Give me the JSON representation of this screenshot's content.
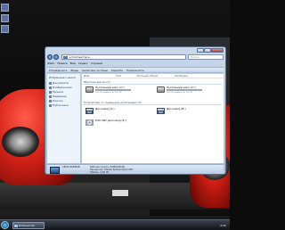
{
  "window": {
    "address": "▸ Компьютер ▸",
    "search_placeholder": "Поиск"
  },
  "menubar": [
    "Файл",
    "Правка",
    "Вид",
    "Сервис",
    "Справка"
  ],
  "toolbar": {
    "organize": "Упорядочить",
    "views": "Виды",
    "properties": "Свойства системы",
    "uninstall": "Удалить",
    "map_drive": "Подключить"
  },
  "nav": {
    "title": "Избранные ссылки",
    "items": [
      "Документы",
      "Изображения",
      "Музыка",
      "Недавние",
      "Поиски",
      "Публичные"
    ]
  },
  "columns": [
    "Имя",
    "Тип",
    "Полный объем",
    "Свободно"
  ],
  "groups": {
    "hard_disks": "Жесткие диски (2)",
    "removable": "Устройства со съемными носителями (3)"
  },
  "drives": [
    {
      "label": "Локальный диск (C:)",
      "info": "24,9 ГБ свободно из 39,0 ГБ",
      "used_fraction": 0.36
    },
    {
      "label": "Локальный диск (D:)",
      "info": "33,3 ГБ свободно из 110 ГБ",
      "used_fraction": 0.7
    }
  ],
  "devices": [
    {
      "label": "Дисковод (A:)"
    },
    {
      "label": "Дисковод (B:)"
    },
    {
      "label": "DVD-RW дисковод (E:)"
    }
  ],
  "details": {
    "computer": "CRAZY-KOMP-PK",
    "domain_label": "Рабочая группа: WORKGROUP",
    "cpu_label": "Процессор: Intel(R) Pentium(R) D CPU",
    "mem_label": "Память: 2,00 ГБ"
  },
  "taskbar": {
    "task_label": "Компьютер",
    "clock": "2:45"
  }
}
